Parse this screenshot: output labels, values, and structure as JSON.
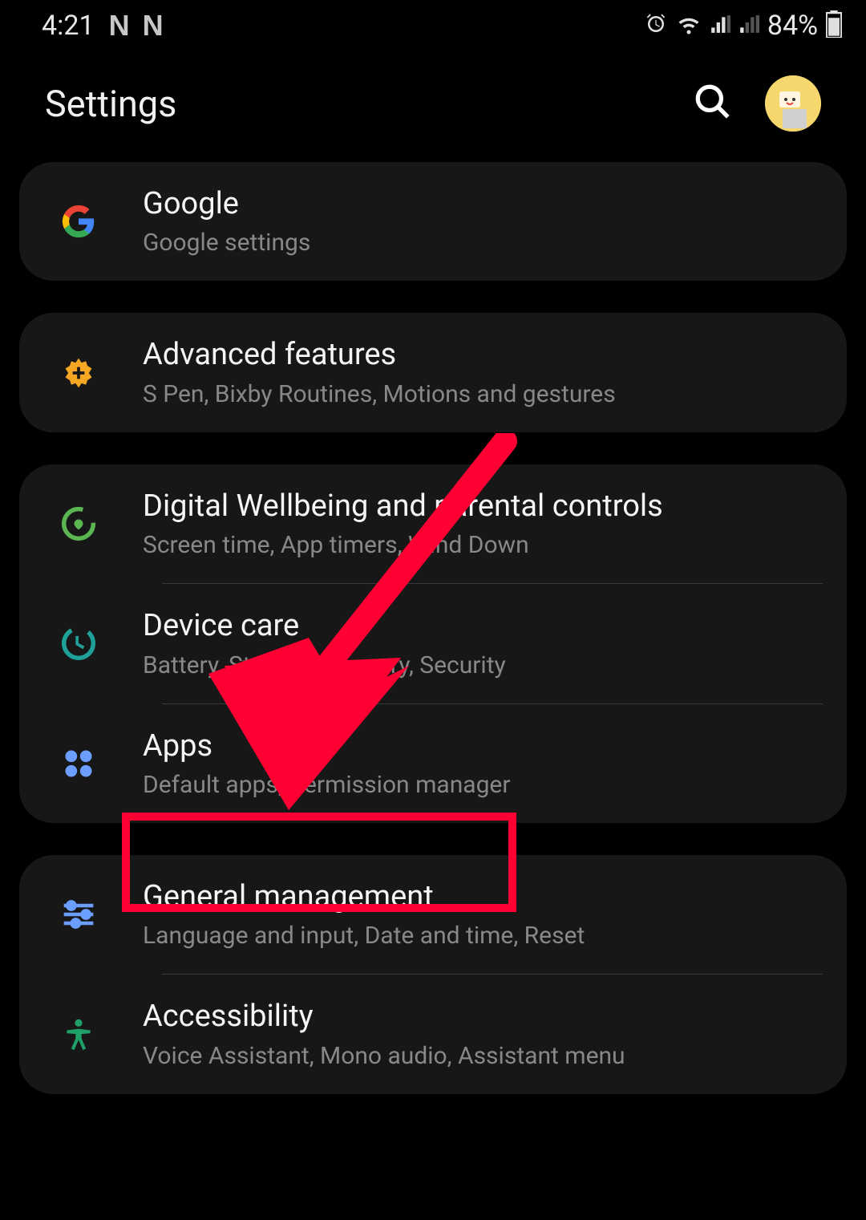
{
  "status_bar": {
    "time": "4:21",
    "notif_icons": [
      "N",
      "N"
    ],
    "battery": "84%"
  },
  "header": {
    "title": "Settings"
  },
  "groups": [
    {
      "items": [
        {
          "id": "google",
          "title": "Google",
          "subtitle": "Google settings"
        }
      ]
    },
    {
      "items": [
        {
          "id": "advanced",
          "title": "Advanced features",
          "subtitle": "S Pen, Bixby Routines, Motions and gestures"
        }
      ]
    },
    {
      "items": [
        {
          "id": "wellbeing",
          "title": "Digital Wellbeing and parental controls",
          "subtitle": "Screen time, App timers, Wind Down"
        },
        {
          "id": "devicecare",
          "title": "Device care",
          "subtitle": "Battery, Storage, Memory, Security"
        },
        {
          "id": "apps",
          "title": "Apps",
          "subtitle": "Default apps, Permission manager"
        }
      ]
    },
    {
      "items": [
        {
          "id": "general",
          "title": "General management",
          "subtitle": "Language and input, Date and time, Reset"
        },
        {
          "id": "accessibility",
          "title": "Accessibility",
          "subtitle": "Voice Assistant, Mono audio, Assistant menu"
        }
      ]
    }
  ],
  "annotation": {
    "highlight_target": "general",
    "arrow_color": "#ff0033"
  }
}
